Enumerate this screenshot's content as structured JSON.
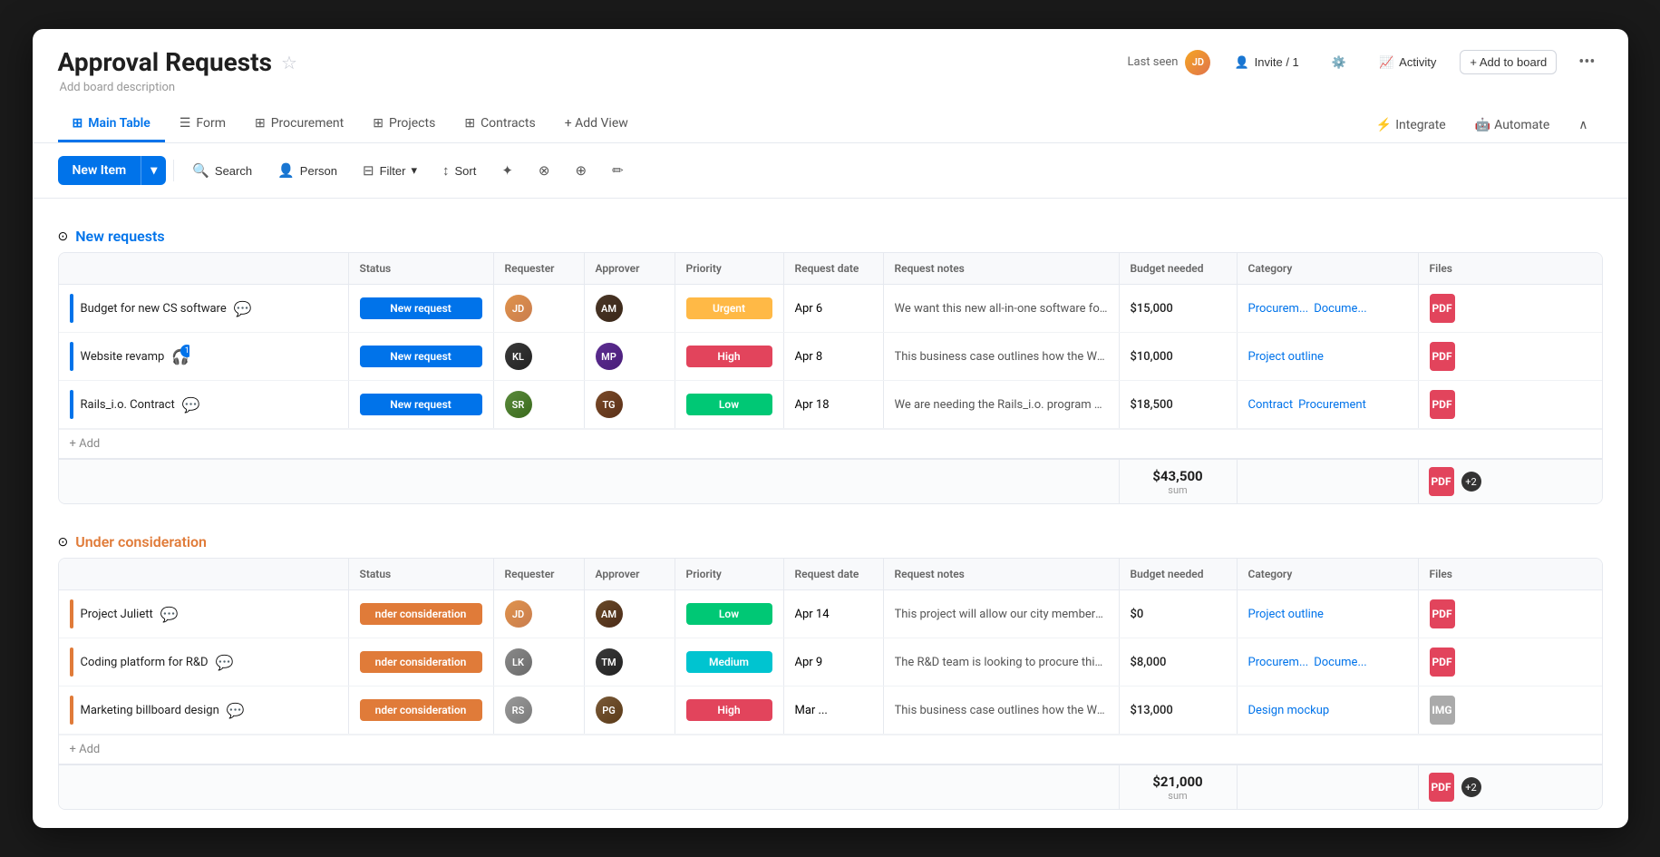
{
  "header": {
    "title": "Approval Requests",
    "subtitle": "Add board description",
    "last_seen_label": "Last seen",
    "invite_label": "Invite / 1",
    "activity_label": "Activity",
    "add_to_board_label": "+ Add to board"
  },
  "tabs": [
    {
      "label": "Main Table",
      "active": true
    },
    {
      "label": "Form"
    },
    {
      "label": "Procurement"
    },
    {
      "label": "Projects"
    },
    {
      "label": "Contracts"
    },
    {
      "label": "+ Add View"
    }
  ],
  "tab_right": [
    {
      "label": "Integrate"
    },
    {
      "label": "Automate"
    }
  ],
  "toolbar": {
    "new_item": "New Item",
    "search": "Search",
    "person": "Person",
    "filter": "Filter",
    "sort": "Sort"
  },
  "groups": [
    {
      "id": "new_requests",
      "title": "New requests",
      "color": "blue",
      "columns": [
        "",
        "Status",
        "Requester",
        "Approver",
        "Priority",
        "Request date",
        "Request notes",
        "Budget needed",
        "Category",
        "Files"
      ],
      "rows": [
        {
          "name": "Budget for new CS software",
          "status": "New request",
          "status_class": "status-new",
          "requester_color": "#c97d4e",
          "approver_color": "#4a3728",
          "priority": "Urgent",
          "priority_class": "priority-urgent",
          "date": "Apr 6",
          "notes": "We want this new all-in-one software for all...",
          "budget": "$15,000",
          "categories": [
            {
              "label": "Procurem...",
              "link": true
            },
            {
              "label": "Docume...",
              "link": true
            }
          ],
          "has_comment": false,
          "has_chat_badge": false
        },
        {
          "name": "Website revamp",
          "status": "New request",
          "status_class": "status-new",
          "requester_color": "#3a3a3a",
          "approver_color": "#5c2d91",
          "priority": "High",
          "priority_class": "priority-high",
          "date": "Apr 8",
          "notes": "This business case outlines how the Web ...",
          "budget": "$10,000",
          "categories": [
            {
              "label": "Project outline",
              "link": true
            }
          ],
          "has_comment": false,
          "has_chat_badge": true
        },
        {
          "name": "Rails_i.o. Contract",
          "status": "New request",
          "status_class": "status-new",
          "requester_color": "#5a8a3c",
          "approver_color": "#7a4a28",
          "priority": "Low",
          "priority_class": "priority-low",
          "date": "Apr 18",
          "notes": "We are needing the Rails_i.o. program by Q...",
          "budget": "$18,500",
          "categories": [
            {
              "label": "Contract",
              "link": true
            },
            {
              "label": "Procurement",
              "link": true
            }
          ],
          "has_comment": false,
          "has_chat_badge": false
        }
      ],
      "sum": "$43,500",
      "sum_label": "sum"
    },
    {
      "id": "under_consideration",
      "title": "Under consideration",
      "color": "orange",
      "columns": [
        "",
        "Status",
        "Requester",
        "Approver",
        "Priority",
        "Request date",
        "Request notes",
        "Budget needed",
        "Category",
        "Files"
      ],
      "rows": [
        {
          "name": "Project Juliett",
          "status": "Under consideration",
          "status_class": "status-under",
          "status_text": "nder consideration",
          "requester_color": "#c97d4e",
          "approver_color": "#4a3728",
          "priority": "Low",
          "priority_class": "priority-low",
          "date": "Apr 14",
          "notes": "This project will allow our city members to ...",
          "budget": "$0",
          "categories": [
            {
              "label": "Project outline",
              "link": true
            }
          ],
          "has_comment": false,
          "has_chat_badge": false
        },
        {
          "name": "Coding platform for R&D",
          "status": "Under consideration",
          "status_class": "status-under",
          "status_text": "nder consideration",
          "requester_color": "#8a8a8a",
          "approver_color": "#3a3a3a",
          "priority": "Medium",
          "priority_class": "priority-medium",
          "date": "Apr 9",
          "notes": "The R&D team is looking to procure this co...",
          "budget": "$8,000",
          "categories": [
            {
              "label": "Procurem...",
              "link": true
            },
            {
              "label": "Docume...",
              "link": true
            }
          ],
          "has_comment": false,
          "has_chat_badge": false
        },
        {
          "name": "Marketing billboard design",
          "status": "Under consideration",
          "status_class": "status-under",
          "status_text": "nder consideration",
          "requester_color": "#9a9a9a",
          "approver_color": "#5c3a28",
          "priority": "High",
          "priority_class": "priority-high",
          "date": "Mar ...",
          "notes": "This business case outlines how the Web ...",
          "budget": "$13,000",
          "categories": [
            {
              "label": "Design mockup",
              "link": true
            }
          ],
          "has_comment": false,
          "has_chat_badge": false
        }
      ],
      "sum": "$21,000",
      "sum_label": "sum"
    }
  ]
}
